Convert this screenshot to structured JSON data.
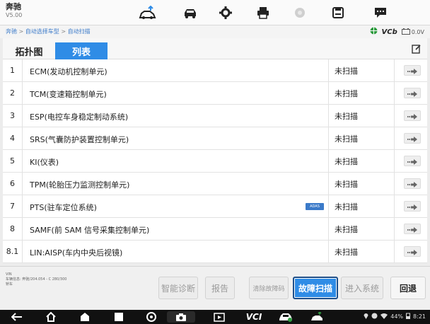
{
  "app": {
    "brand": "奔驰",
    "version": "V5.00"
  },
  "breadcrumb": {
    "items": [
      "奔驰",
      "自动选择车型",
      "自动扫描"
    ],
    "separator": ">"
  },
  "status": {
    "vcb_label": "VCb",
    "voltage": "0.0V"
  },
  "tabs": [
    {
      "label": "拓扑图",
      "active": false
    },
    {
      "label": "列表",
      "active": true
    }
  ],
  "systems": [
    {
      "num": "1",
      "name": "ECM(发动机控制单元)",
      "status": "未扫描",
      "badge": ""
    },
    {
      "num": "2",
      "name": "TCM(变速箱控制单元)",
      "status": "未扫描",
      "badge": ""
    },
    {
      "num": "3",
      "name": "ESP(电控车身稳定制动系统)",
      "status": "未扫描",
      "badge": ""
    },
    {
      "num": "4",
      "name": "SRS(气囊防护装置控制单元)",
      "status": "未扫描",
      "badge": ""
    },
    {
      "num": "5",
      "name": "KI(仪表)",
      "status": "未扫描",
      "badge": ""
    },
    {
      "num": "6",
      "name": "TPM(轮胎压力监测控制单元)",
      "status": "未扫描",
      "badge": ""
    },
    {
      "num": "7",
      "name": "PTS(驻车定位系统)",
      "status": "未扫描",
      "badge": "ADAS"
    },
    {
      "num": "8",
      "name": "SAMF(前 SAM 信号采集控制单元)",
      "status": "未扫描",
      "badge": ""
    },
    {
      "num": "8.1",
      "name": "LIN:AISP(车内中央后视镜)",
      "status": "未扫描",
      "badge": ""
    }
  ],
  "vehicle_info": {
    "line1": "VIN",
    "line2": "车辆信息: 奔驰/204.054 - C 280/300",
    "line3": "轿车"
  },
  "actions": {
    "smart_diag": "智能诊断",
    "report": "报告",
    "clear_dtc": "清除故障码",
    "fault_scan": "故障扫描",
    "enter_system": "进入系统",
    "back": "回退"
  },
  "system_status": {
    "battery": "44%",
    "time": "8:21"
  },
  "colors": {
    "accent": "#2f8ce6",
    "link": "#3b7ac9"
  }
}
